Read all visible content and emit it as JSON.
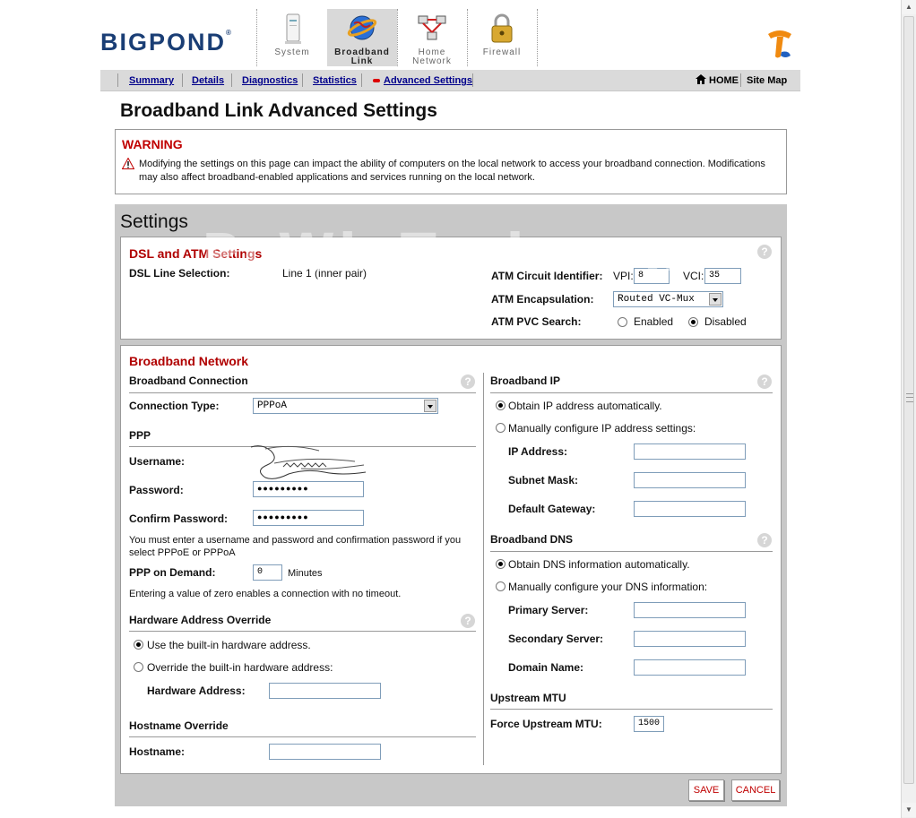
{
  "brand": {
    "logo": "BIGPOND",
    "logo_mark": "®"
  },
  "tabs": [
    {
      "label_line1": "System",
      "label_line2": "",
      "active": false,
      "icon": "system-tower-icon"
    },
    {
      "label_line1": "Broadband",
      "label_line2": "Link",
      "active": true,
      "icon": "globe-icon"
    },
    {
      "label_line1": "Home",
      "label_line2": "Network",
      "active": false,
      "icon": "network-icon"
    },
    {
      "label_line1": "Firewall",
      "label_line2": "",
      "active": false,
      "icon": "padlock-icon"
    }
  ],
  "nav": {
    "items": [
      "Summary",
      "Details",
      "Diagnostics",
      "Statistics",
      "Advanced Settings"
    ],
    "active": "Advanced Settings",
    "home": "HOME",
    "sitemap": "Site Map"
  },
  "page_title": "Broadband Link Advanced Settings",
  "warning": {
    "title": "WARNING",
    "text": "Modifying the settings on this page can impact the ability of computers on the local network to access your broadband connection. Modifications may also affect broadband-enabled applications and services running on the local network."
  },
  "settings": {
    "title": "Settings",
    "watermark": "PcWinTech.com",
    "dsl": {
      "title": "DSL and ATM Settings",
      "line_selection_label": "DSL Line Selection:",
      "line_selection_value": "Line 1 (inner pair)",
      "atm_circuit_label": "ATM Circuit Identifier:",
      "vpi_label": "VPI:",
      "vpi_value": "8",
      "vci_label": "VCI:",
      "vci_value": "35",
      "encapsulation_label": "ATM Encapsulation:",
      "encapsulation_value": "Routed VC-Mux",
      "pvc_search_label": "ATM PVC Search:",
      "pvc_enabled": "Enabled",
      "pvc_disabled": "Disabled",
      "pvc_selected": "Disabled"
    },
    "network": {
      "title": "Broadband Network",
      "connection": {
        "heading": "Broadband Connection",
        "type_label": "Connection Type:",
        "type_value": "PPPoA"
      },
      "ppp": {
        "heading": "PPP",
        "username_label": "Username:",
        "password_label": "Password:",
        "password_value": "●●●●●●●●●",
        "confirm_label": "Confirm Password:",
        "confirm_value": "●●●●●●●●●",
        "note": "You must enter a username and password and confirmation password if you select PPPoE or PPPoA",
        "demand_label": "PPP on Demand:",
        "demand_value": "0",
        "demand_unit": "Minutes",
        "demand_note": "Entering a value of zero enables a connection with no timeout."
      },
      "hw": {
        "heading": "Hardware Address Override",
        "opt_builtin": "Use the built-in hardware address.",
        "opt_override": "Override the built-in hardware address:",
        "address_label": "Hardware Address:",
        "address_value": ""
      },
      "hostname": {
        "heading": "Hostname Override",
        "label": "Hostname:",
        "value": ""
      },
      "ip": {
        "heading": "Broadband IP",
        "opt_auto": "Obtain IP address automatically.",
        "opt_manual": "Manually configure IP address settings:",
        "ip_label": "IP Address:",
        "mask_label": "Subnet Mask:",
        "gateway_label": "Default Gateway:"
      },
      "dns": {
        "heading": "Broadband DNS",
        "opt_auto": "Obtain DNS information automatically.",
        "opt_manual": "Manually configure your DNS information:",
        "primary_label": "Primary Server:",
        "secondary_label": "Secondary Server:",
        "domain_label": "Domain Name:"
      },
      "mtu": {
        "heading": "Upstream MTU",
        "label": "Force Upstream MTU:",
        "value": "1500"
      }
    }
  },
  "buttons": {
    "save": "SAVE",
    "cancel": "CANCEL"
  },
  "colors": {
    "accent_red": "#c00000",
    "link_blue": "#00008b",
    "brand_blue": "#1a3e75",
    "panel_gray": "#c8c8c8"
  },
  "help_glyph": "?"
}
